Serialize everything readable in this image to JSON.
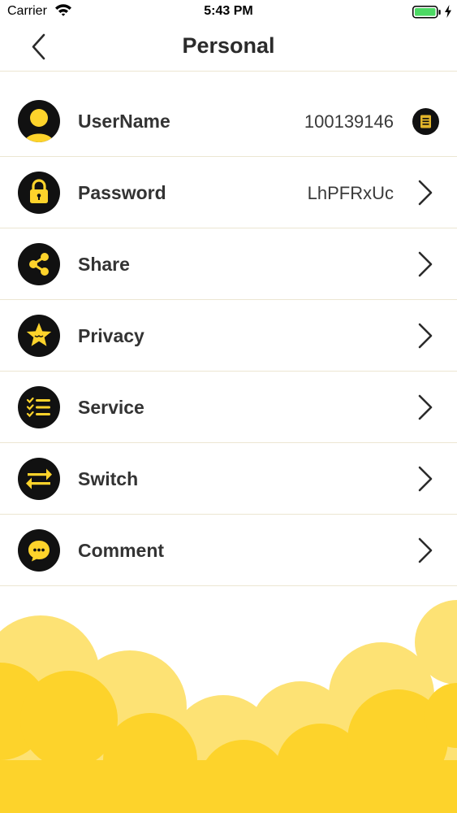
{
  "status_bar": {
    "carrier": "Carrier",
    "time": "5:43 PM",
    "battery_color": "#4cd964"
  },
  "nav": {
    "title": "Personal",
    "back_icon": "chevron-left-icon"
  },
  "theme": {
    "accent": "#fdd32b",
    "accent_light": "#fde274",
    "icon_bg": "#111111",
    "divider": "#ece6d2"
  },
  "menu": {
    "items": [
      {
        "label": "UserName",
        "value": "100139146",
        "icon": "user-icon",
        "action": "copy-icon"
      },
      {
        "label": "Password",
        "value": "LhPFRxUc",
        "icon": "lock-icon",
        "action": "chevron-right-icon"
      },
      {
        "label": "Share",
        "value": "",
        "icon": "share-icon",
        "action": "chevron-right-icon"
      },
      {
        "label": "Privacy",
        "value": "",
        "icon": "star-icon",
        "action": "chevron-right-icon"
      },
      {
        "label": "Service",
        "value": "",
        "icon": "checklist-icon",
        "action": "chevron-right-icon"
      },
      {
        "label": "Switch",
        "value": "",
        "icon": "swap-arrows-icon",
        "action": "chevron-right-icon"
      },
      {
        "label": "Comment",
        "value": "",
        "icon": "chat-bubble-icon",
        "action": "chevron-right-icon"
      }
    ]
  }
}
